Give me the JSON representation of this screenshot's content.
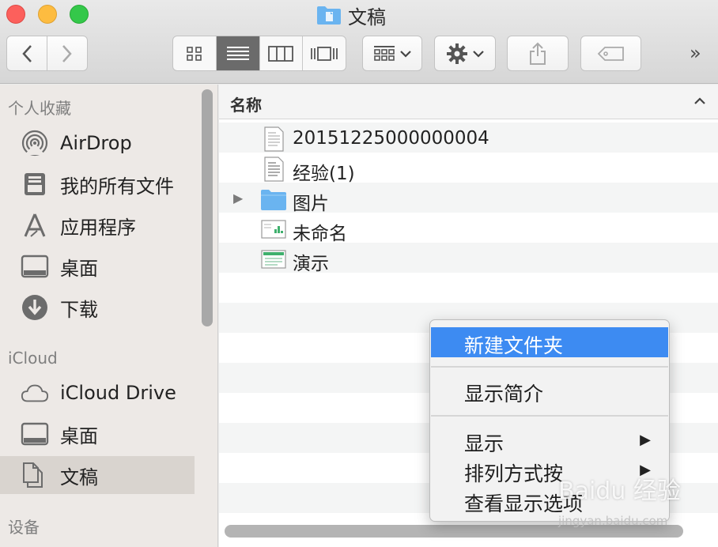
{
  "window": {
    "title": "文稿"
  },
  "toolbar": {
    "more": "»"
  },
  "sidebar": {
    "section_favorites": "个人收藏",
    "favorites": [
      {
        "label": "AirDrop",
        "icon": "airdrop-icon"
      },
      {
        "label": "我的所有文件",
        "icon": "all-files-icon"
      },
      {
        "label": "应用程序",
        "icon": "applications-icon"
      },
      {
        "label": "桌面",
        "icon": "desktop-icon"
      },
      {
        "label": "下载",
        "icon": "downloads-icon"
      }
    ],
    "section_icloud": "iCloud",
    "icloud": [
      {
        "label": "iCloud Drive",
        "icon": "icloud-icon"
      },
      {
        "label": "桌面",
        "icon": "desktop-icon"
      },
      {
        "label": "文稿",
        "icon": "documents-icon",
        "selected": true
      }
    ],
    "section_devices": "设备"
  },
  "list": {
    "column_name": "名称",
    "sort_indicator": "^",
    "files": [
      {
        "name": "20151225000000004",
        "icon": "document-icon"
      },
      {
        "name": "经验(1)",
        "icon": "document-icon"
      },
      {
        "name": "图片",
        "icon": "folder-icon",
        "expandable": true
      },
      {
        "name": "未命名",
        "icon": "chart-file-icon"
      },
      {
        "name": "演示",
        "icon": "presentation-file-icon"
      }
    ]
  },
  "context_menu": {
    "items": [
      {
        "label": "新建文件夹",
        "highlighted": true
      },
      {
        "label": "显示简介"
      },
      {
        "label": "显示",
        "submenu": true
      },
      {
        "label": "排列方式按",
        "submenu": true
      },
      {
        "label": "查看显示选项"
      }
    ],
    "submenu_arrow": "▶"
  },
  "watermark": {
    "text": "Baidu 经验",
    "url": "jingyan.baidu.com"
  },
  "colors": {
    "highlight": "#3d8bf2",
    "folder": "#6ab4f0"
  }
}
